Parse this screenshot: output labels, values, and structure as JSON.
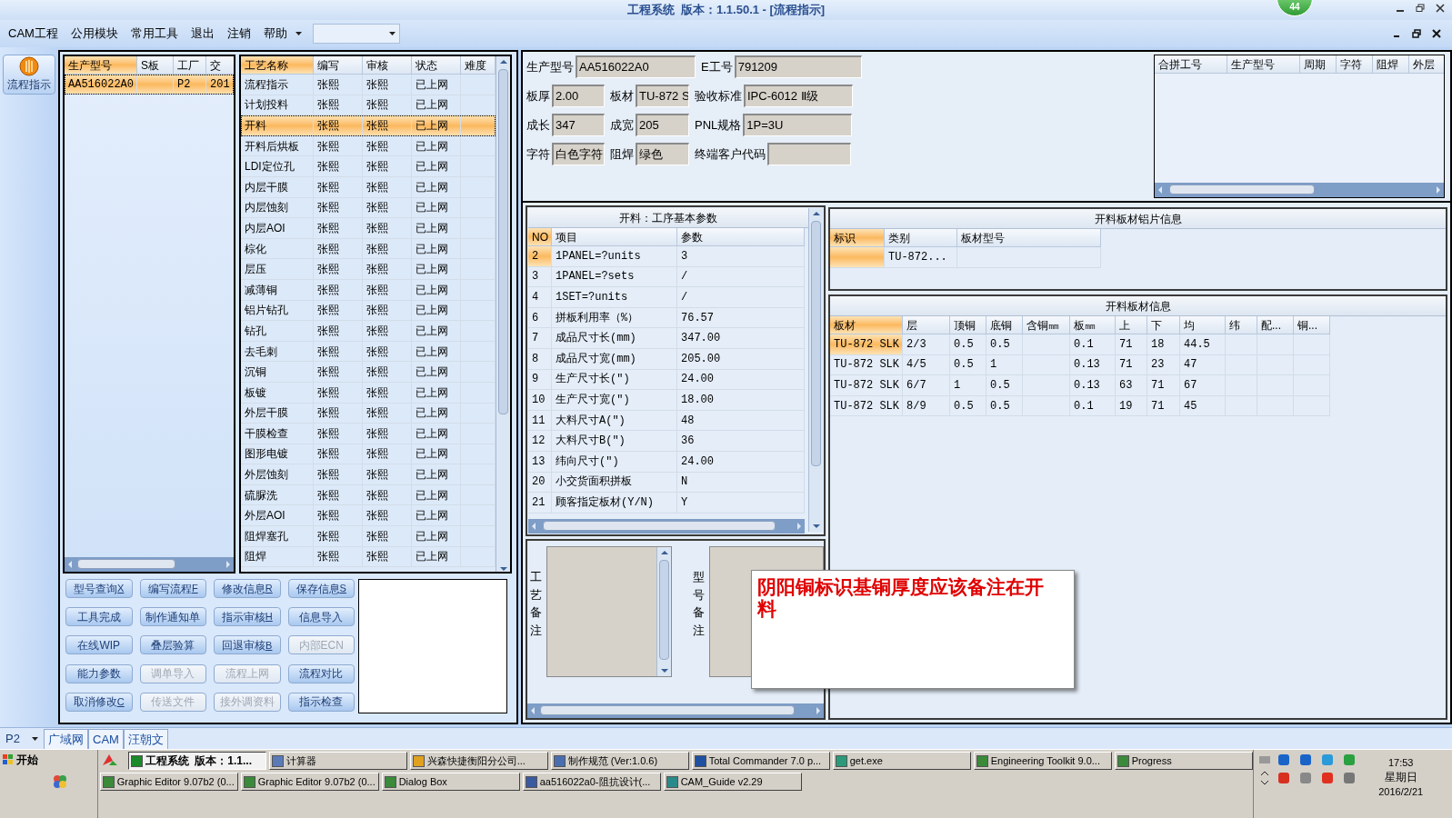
{
  "window": {
    "title": "工程系统  版本：1.1.50.1 - [流程指示]",
    "badge": "44"
  },
  "menu": [
    "CAM工程",
    "公用模块",
    "常用工具",
    "退出",
    "注销",
    "帮助"
  ],
  "toolbar": {
    "button": "流程指示"
  },
  "orders_table": {
    "columns": [
      {
        "label": "生产型号",
        "selected": true
      },
      {
        "label": "S板",
        "selected": false
      },
      {
        "label": "工厂",
        "selected": false
      },
      {
        "label": "交",
        "selected": false
      }
    ],
    "rows": [
      {
        "cells": [
          "AA516022A0",
          null,
          "P2",
          "201"
        ],
        "selected": true
      }
    ]
  },
  "process_table": {
    "columns": [
      {
        "label": "工艺名称",
        "selected": true
      },
      {
        "label": "编写",
        "selected": false
      },
      {
        "label": "审核",
        "selected": false
      },
      {
        "label": "状态",
        "selected": false
      },
      {
        "label": "难度",
        "selected": false
      }
    ],
    "rows": [
      {
        "cells": [
          "流程指示",
          "张熙",
          "张熙",
          "已上网"
        ],
        "selected": false
      },
      {
        "cells": [
          "计划投料",
          "张熙",
          "张熙",
          "已上网"
        ],
        "selected": false
      },
      {
        "cells": [
          "开料",
          "张熙",
          "张熙",
          "已上网"
        ],
        "selected": true
      },
      {
        "cells": [
          "开料后烘板",
          "张熙",
          "张熙",
          "已上网"
        ],
        "selected": false
      },
      {
        "cells": [
          "LDI定位孔",
          "张熙",
          "张熙",
          "已上网"
        ],
        "selected": false
      },
      {
        "cells": [
          "内层干膜",
          "张熙",
          "张熙",
          "已上网"
        ],
        "selected": false
      },
      {
        "cells": [
          "内层蚀刻",
          "张熙",
          "张熙",
          "已上网"
        ],
        "selected": false
      },
      {
        "cells": [
          "内层AOI",
          "张熙",
          "张熙",
          "已上网"
        ],
        "selected": false
      },
      {
        "cells": [
          "棕化",
          "张熙",
          "张熙",
          "已上网"
        ],
        "selected": false
      },
      {
        "cells": [
          "层压",
          "张熙",
          "张熙",
          "已上网"
        ],
        "selected": false
      },
      {
        "cells": [
          "减薄铜",
          "张熙",
          "张熙",
          "已上网"
        ],
        "selected": false
      },
      {
        "cells": [
          "铝片钻孔",
          "张熙",
          "张熙",
          "已上网"
        ],
        "selected": false
      },
      {
        "cells": [
          "钻孔",
          "张熙",
          "张熙",
          "已上网"
        ],
        "selected": false
      },
      {
        "cells": [
          "去毛刺",
          "张熙",
          "张熙",
          "已上网"
        ],
        "selected": false
      },
      {
        "cells": [
          "沉铜",
          "张熙",
          "张熙",
          "已上网"
        ],
        "selected": false
      },
      {
        "cells": [
          "板镀",
          "张熙",
          "张熙",
          "已上网"
        ],
        "selected": false
      },
      {
        "cells": [
          "外层干膜",
          "张熙",
          "张熙",
          "已上网"
        ],
        "selected": false
      },
      {
        "cells": [
          "干膜检查",
          "张熙",
          "张熙",
          "已上网"
        ],
        "selected": false
      },
      {
        "cells": [
          "图形电镀",
          "张熙",
          "张熙",
          "已上网"
        ],
        "selected": false
      },
      {
        "cells": [
          "外层蚀刻",
          "张熙",
          "张熙",
          "已上网"
        ],
        "selected": false
      },
      {
        "cells": [
          "硫脲洗",
          "张熙",
          "张熙",
          "已上网"
        ],
        "selected": false
      },
      {
        "cells": [
          "外层AOI",
          "张熙",
          "张熙",
          "已上网"
        ],
        "selected": false
      },
      {
        "cells": [
          "阻焊塞孔",
          "张熙",
          "张熙",
          "已上网"
        ],
        "selected": false
      },
      {
        "cells": [
          "阻焊",
          "张熙",
          "张熙",
          "已上网"
        ],
        "selected": false
      }
    ]
  },
  "buttons": [
    {
      "label": "型号查询",
      "shortcut": "X",
      "disabled": false
    },
    {
      "label": "编写流程",
      "shortcut": "F",
      "disabled": false
    },
    {
      "label": "修改信息",
      "shortcut": "R",
      "disabled": false
    },
    {
      "label": "保存信息",
      "shortcut": "S",
      "disabled": false
    },
    {
      "label": "工具完成",
      "disabled": false
    },
    {
      "label": "制作通知单",
      "disabled": false
    },
    {
      "label": "指示审核",
      "shortcut": "H",
      "disabled": false
    },
    {
      "label": "信息导入",
      "disabled": false
    },
    {
      "label": "在线WIP",
      "disabled": false
    },
    {
      "label": "叠层验算",
      "disabled": false
    },
    {
      "label": "回退审核",
      "shortcut": "B",
      "disabled": false
    },
    {
      "label": "内部ECN",
      "disabled": true
    },
    {
      "label": "能力参数",
      "disabled": false
    },
    {
      "label": "调单导入",
      "disabled": true
    },
    {
      "label": "流程上网",
      "disabled": true
    },
    {
      "label": "流程对比",
      "disabled": false
    },
    {
      "label": "取消修改",
      "shortcut": "C",
      "disabled": false
    },
    {
      "label": "传送文件",
      "disabled": true
    },
    {
      "label": "接外调资料",
      "disabled": true
    },
    {
      "label": "指示检查",
      "disabled": false
    }
  ],
  "form": [
    [
      {
        "label": "生产型号",
        "value": "AA516022A0"
      },
      {
        "label": "E工号",
        "value": "791209"
      }
    ],
    [
      {
        "label": "板厚",
        "value": "2.00"
      },
      {
        "label": "板材",
        "value": "TU-872 S"
      },
      {
        "label": "验收标准",
        "value": "IPC-6012 Ⅱ级"
      }
    ],
    [
      {
        "label": "成长",
        "value": "347"
      },
      {
        "label": "成宽",
        "value": "205"
      },
      {
        "label": "PNL规格",
        "value": "1P=3U"
      }
    ],
    [
      {
        "label": "字符",
        "value": "白色字符"
      },
      {
        "label": "阻焊",
        "value": "绿色"
      },
      {
        "label": "终端客户代码"
      }
    ]
  ],
  "merge_table": {
    "columns": [
      {
        "label": "合拼工号",
        "selected": false
      },
      {
        "label": "生产型号",
        "selected": false
      },
      {
        "label": "周期",
        "selected": false
      },
      {
        "label": "字符",
        "selected": false
      },
      {
        "label": "阻焊",
        "selected": false
      },
      {
        "label": "外层",
        "selected": false
      }
    ]
  },
  "params_table": {
    "title": "开料：工序基本参数",
    "columns": [
      {
        "label": "NO",
        "selected": true
      },
      {
        "label": "项目",
        "selected": false
      },
      {
        "label": "参数",
        "selected": false
      }
    ],
    "rows": [
      {
        "cells": [
          "2",
          "1PANEL=?units",
          "3"
        ],
        "selected": true
      },
      {
        "cells": [
          "3",
          "1PANEL=?sets",
          "/"
        ],
        "selected": false
      },
      {
        "cells": [
          "4",
          "1SET=?units",
          "/"
        ],
        "selected": false
      },
      {
        "cells": [
          "6",
          "拼板利用率（%）",
          "76.57"
        ],
        "selected": false
      },
      {
        "cells": [
          "7",
          "成品尺寸长(mm)",
          "347.00"
        ],
        "selected": false
      },
      {
        "cells": [
          "8",
          "成品尺寸宽(mm)",
          "205.00"
        ],
        "selected": false
      },
      {
        "cells": [
          "9",
          "生产尺寸长(\")",
          "24.00"
        ],
        "selected": false
      },
      {
        "cells": [
          "10",
          "生产尺寸宽(\")",
          "18.00"
        ],
        "selected": false
      },
      {
        "cells": [
          "11",
          "大料尺寸A(\")",
          "48"
        ],
        "selected": false
      },
      {
        "cells": [
          "12",
          "大料尺寸B(\")",
          "36"
        ],
        "selected": false
      },
      {
        "cells": [
          "13",
          "纬向尺寸(\")",
          "24.00"
        ],
        "selected": false
      },
      {
        "cells": [
          "20",
          "小交货面积拼板",
          "N"
        ],
        "selected": false
      },
      {
        "cells": [
          "21",
          "顾客指定板材(Y/N)",
          "Y"
        ],
        "selected": false
      }
    ]
  },
  "foil_table": {
    "title": "开料板材铝片信息",
    "columns": [
      {
        "label": "标识",
        "selected": true
      },
      {
        "label": "类别",
        "selected": false
      },
      {
        "label": "板材型号",
        "selected": false
      }
    ],
    "rows": [
      {
        "cells": [
          null,
          "TU-872...",
          null
        ],
        "selected": true
      }
    ]
  },
  "board_table": {
    "title": "开料板材信息",
    "columns": [
      {
        "label": "板材",
        "selected": true
      },
      {
        "label": "层",
        "selected": false
      },
      {
        "label": "顶铜",
        "selected": false
      },
      {
        "label": "底铜",
        "selected": false
      },
      {
        "label": "含铜㎜",
        "selected": false
      },
      {
        "label": "板㎜",
        "selected": false
      },
      {
        "label": "上",
        "selected": false
      },
      {
        "label": "下",
        "selected": false
      },
      {
        "label": "均",
        "selected": false
      },
      {
        "label": "纬",
        "selected": false
      },
      {
        "label": "配...",
        "selected": false
      },
      {
        "label": "铜...",
        "selected": false
      }
    ],
    "rows": [
      {
        "cells": [
          "TU-872 SLK",
          "2/3",
          "0.5",
          "0.5",
          null,
          "0.1",
          "71",
          "18",
          "44.5",
          null,
          null,
          null
        ],
        "selected": true
      },
      {
        "cells": [
          "TU-872 SLK",
          "4/5",
          "0.5",
          "1",
          null,
          "0.13",
          "71",
          "23",
          "47",
          null,
          null,
          null
        ],
        "selected": false
      },
      {
        "cells": [
          "TU-872 SLK",
          "6/7",
          "1",
          "0.5",
          null,
          "0.13",
          "63",
          "71",
          "67",
          null,
          null,
          null
        ],
        "selected": false
      },
      {
        "cells": [
          "TU-872 SLK",
          "8/9",
          "0.5",
          "0.5",
          null,
          "0.1",
          "19",
          "71",
          "45",
          null,
          null,
          null
        ],
        "selected": false
      }
    ]
  },
  "notes": {
    "process_label": "工艺备注",
    "model_label": "型号备注"
  },
  "popup": {
    "text": "阴阳铜标识基铜厚度应该备注在开料"
  },
  "bottom_tabs": {
    "selector": "P2",
    "tabs": [
      "广域网",
      "CAM",
      "汪朝文"
    ]
  },
  "taskbar": {
    "start": "开始",
    "tasks": [
      {
        "label": "工程系统  版本：1.1...",
        "selected": true,
        "color": "#1a8a2a"
      },
      {
        "label": "计算器",
        "selected": false,
        "color": "#5a7ab8"
      },
      {
        "label": "兴森快捷衡阳分公司...",
        "selected": false,
        "color": "#e0a020"
      },
      {
        "label": "制作规范 (Ver:1.0.6)",
        "selected": false,
        "color": "#4a6fb0"
      },
      {
        "label": "Total Commander 7.0 p...",
        "selected": false,
        "color": "#2050a0"
      },
      {
        "label": "get.exe",
        "selected": false,
        "color": "#2a9a7a"
      },
      {
        "label": "Engineering Toolkit 9.0...",
        "selected": false,
        "color": "#3a8a3a"
      },
      {
        "label": "Progress",
        "selected": false,
        "color": "#3a8a3a"
      }
    ],
    "tasks2": [
      {
        "label": "Graphic Editor 9.07b2 (0...",
        "selected": false,
        "color": "#3a8a3a"
      },
      {
        "label": "Graphic Editor 9.07b2 (0...",
        "selected": false,
        "color": "#3a8a3a"
      },
      {
        "label": "Dialog Box",
        "selected": false,
        "color": "#3a8a3a"
      },
      {
        "label": "aa516022a0-阻抗设计(...",
        "selected": false,
        "color": "#3a5aa0"
      },
      {
        "label": "CAM_Guide v2.29",
        "selected": false,
        "color": "#2a8a8a"
      }
    ],
    "clock": {
      "time": "17:53",
      "weekday": "星期日",
      "date": "2016/2/21"
    }
  }
}
